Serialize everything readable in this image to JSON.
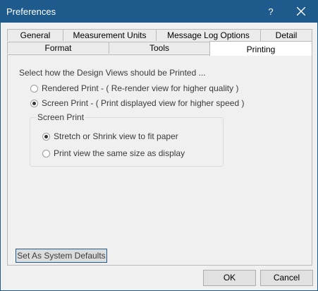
{
  "window": {
    "title": "Preferences",
    "help_glyph": "?"
  },
  "tabs": {
    "row1": [
      "General",
      "Measurement Units",
      "Message Log Options",
      "Detail"
    ],
    "row2": [
      "Format",
      "Tools",
      "Printing"
    ],
    "active": "Printing"
  },
  "printing": {
    "caption": "Select how the Design Views should be Printed ...",
    "mode_options": [
      {
        "label": "Rendered Print - ( Re-render view for higher quality )",
        "checked": false
      },
      {
        "label": "Screen Print - ( Print displayed view for higher speed )",
        "checked": true
      }
    ],
    "screen_print_group": {
      "legend": "Screen Print",
      "options": [
        {
          "label": "Stretch or Shrink view to fit paper",
          "checked": true
        },
        {
          "label": "Print view the same size as display",
          "checked": false
        }
      ]
    },
    "system_defaults_label": "Set As System Defaults"
  },
  "footer": {
    "ok_label": "OK",
    "cancel_label": "Cancel"
  }
}
